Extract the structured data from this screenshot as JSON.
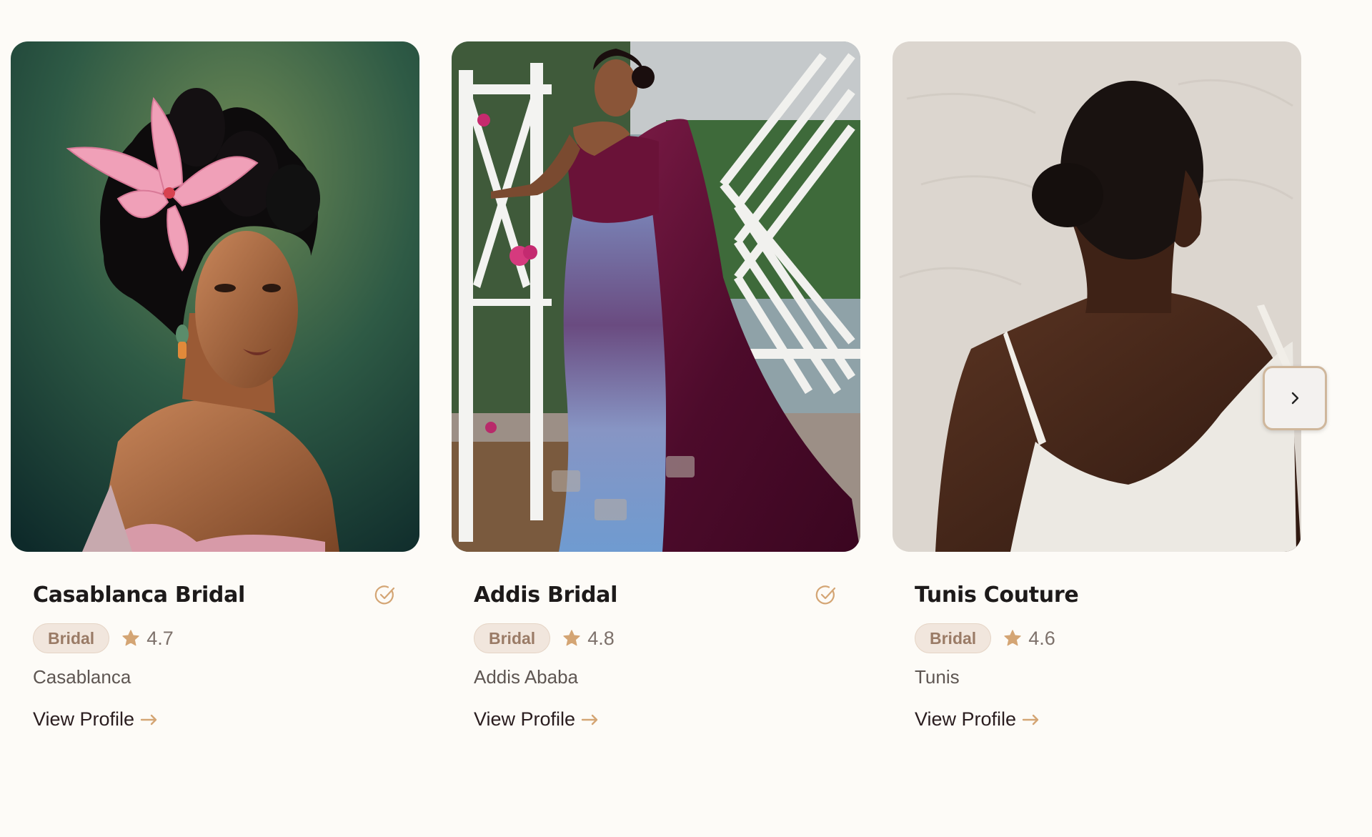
{
  "colors": {
    "background": "#fdfbf7",
    "accent": "#d4a574",
    "badge_bg": "#f1e6dd",
    "badge_text": "#9a7b66",
    "title_text": "#1d1a1a"
  },
  "cards": [
    {
      "title": "Casablanca Bridal",
      "verified": true,
      "category": "Bridal",
      "rating": "4.7",
      "location": "Casablanca",
      "link_label": "View Profile",
      "image_alt": "Portrait of woman with pink lily in updo hair"
    },
    {
      "title": "Addis Bridal",
      "verified": true,
      "category": "Bridal",
      "rating": "4.8",
      "location": "Addis Ababa",
      "link_label": "View Profile",
      "image_alt": "Woman in velvet burgundy and sequined gown by white garden gate"
    },
    {
      "title": "Tunis Couture",
      "verified": false,
      "category": "Bridal",
      "rating": "4.6",
      "location": "Tunis",
      "link_label": "View Profile",
      "image_alt": "Painting of woman from behind in white slip dress"
    }
  ],
  "icons": {
    "verified": "check-circle-icon",
    "rating": "star-icon",
    "link": "arrow-right-icon",
    "next": "chevron-right-icon"
  }
}
